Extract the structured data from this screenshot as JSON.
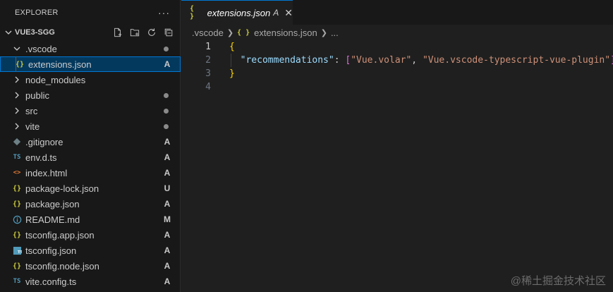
{
  "explorer": {
    "title": "EXPLORER",
    "more": "···",
    "project": "VUE3-SGG",
    "actions": [
      "new-file-icon",
      "new-folder-icon",
      "refresh-icon",
      "collapse-all-icon"
    ]
  },
  "tree": [
    {
      "name": "dotvscode",
      "label": ".vscode",
      "kind": "folder-open",
      "status": "dot"
    },
    {
      "name": "extensions-json",
      "label": "extensions.json",
      "kind": "json",
      "status": "A",
      "selected": true,
      "nested": true
    },
    {
      "name": "node-modules",
      "label": "node_modules",
      "kind": "folder",
      "status": ""
    },
    {
      "name": "public",
      "label": "public",
      "kind": "folder",
      "status": "dot"
    },
    {
      "name": "src",
      "label": "src",
      "kind": "folder",
      "status": "dot"
    },
    {
      "name": "vite",
      "label": "vite",
      "kind": "folder",
      "status": "dot"
    },
    {
      "name": "gitignore",
      "label": ".gitignore",
      "kind": "git",
      "status": "A"
    },
    {
      "name": "env-d-ts",
      "label": "env.d.ts",
      "kind": "ts",
      "status": "A"
    },
    {
      "name": "index-html",
      "label": "index.html",
      "kind": "html",
      "status": "A"
    },
    {
      "name": "package-lock-json",
      "label": "package-lock.json",
      "kind": "json",
      "status": "U"
    },
    {
      "name": "package-json",
      "label": "package.json",
      "kind": "json",
      "status": "A"
    },
    {
      "name": "readme-md",
      "label": "README.md",
      "kind": "info",
      "status": "M"
    },
    {
      "name": "tsconfig-app-json",
      "label": "tsconfig.app.json",
      "kind": "json",
      "status": "A"
    },
    {
      "name": "tsconfig-json",
      "label": "tsconfig.json",
      "kind": "tsconfig",
      "status": "A"
    },
    {
      "name": "tsconfig-node-json",
      "label": "tsconfig.node.json",
      "kind": "json",
      "status": "A"
    },
    {
      "name": "vite-config-ts",
      "label": "vite.config.ts",
      "kind": "ts",
      "status": "A"
    }
  ],
  "tab": {
    "icon": "{ }",
    "name": "extensions.json",
    "status": "A",
    "close": "✕"
  },
  "breadcrumb": {
    "folder": ".vscode",
    "file": "extensions.json",
    "rest": "..."
  },
  "code": {
    "line_numbers": [
      "1",
      "2",
      "3",
      "4"
    ],
    "open_brace": "{",
    "key": "\"recommendations\"",
    "colon": ": ",
    "open_bracket": "[",
    "value1": "\"Vue.volar\"",
    "comma": ", ",
    "value2": "\"Vue.vscode-typescript-vue-plugin\"",
    "close_bracket": "]",
    "close_brace": "}"
  },
  "watermark": "@稀土掘金技术社区",
  "colors": {
    "accent": "#0078d4",
    "selection": "#04395e",
    "json_icon": "#cbcb41",
    "ts_icon": "#519aba",
    "html_icon": "#e37933",
    "git_icon": "#6d8086"
  }
}
